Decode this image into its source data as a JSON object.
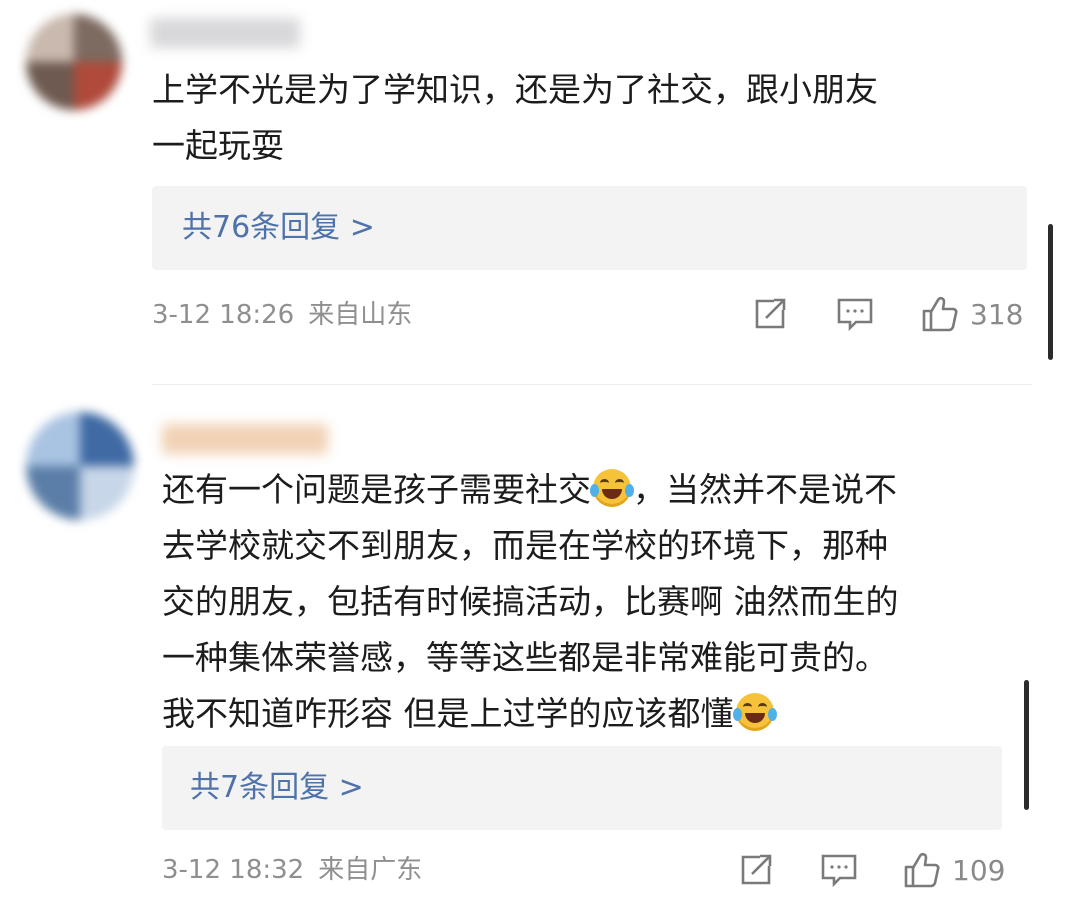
{
  "comments": [
    {
      "body_lines": [
        "上学不光是为了学知识，还是为了社交，跟小朋友",
        "一起玩耍"
      ],
      "replies_label": "共76条回复 >",
      "timestamp": "3-12 18:26",
      "location": "来自山东",
      "likes": "318"
    },
    {
      "body_lines": [
        [
          "还有一个问题是孩子需要社交",
          "，当然并不是说不"
        ],
        "去学校就交不到朋友，而是在学校的环境下，那种",
        "交的朋友，包括有时候搞活动，比赛啊 油然而生的",
        "一种集体荣誉感，等等这些都是非常难能可贵的。",
        [
          "我不知道咋形容 但是上过学的应该都懂",
          ""
        ]
      ],
      "replies_label": "共7条回复 >",
      "timestamp": "3-12 18:32",
      "location": "来自广东",
      "likes": "109"
    }
  ],
  "icons": {
    "repost": "repost-icon",
    "comment": "comment-icon",
    "like": "thumbs-up-icon",
    "emoji": "laughing-tears-emoji"
  },
  "colors": {
    "reply_link": "#4f72a8",
    "meta_text": "#8f8f8f",
    "reply_box_bg": "#f3f3f4",
    "emoji_face": "#f5c23a"
  }
}
